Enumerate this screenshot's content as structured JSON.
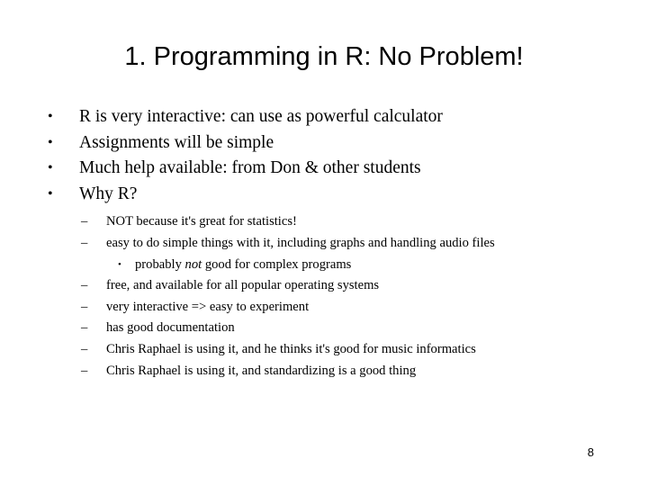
{
  "slide": {
    "title": "1. Programming in R: No Problem!",
    "background_color": "#ffffff",
    "text_color": "#000000",
    "page_number": "8",
    "markers": {
      "level1": "•",
      "level2": "–",
      "level3": "•"
    },
    "bullets": [
      {
        "level": 1,
        "text": "R is very interactive: can use as powerful calculator"
      },
      {
        "level": 1,
        "text": "Assignments will be simple"
      },
      {
        "level": 1,
        "text": "Much help available: from Don & other students"
      },
      {
        "level": 1,
        "text": "Why R?"
      },
      {
        "level": 2,
        "text": "NOT because it's great for statistics!"
      },
      {
        "level": 2,
        "text": "easy to do simple things with it, including graphs and handling audio files"
      },
      {
        "level": 3,
        "text_before": "probably ",
        "text_italic": "not",
        "text_after": " good for complex programs"
      },
      {
        "level": 2,
        "text": "free, and available for all popular operating systems"
      },
      {
        "level": 2,
        "text": "very interactive => easy to experiment"
      },
      {
        "level": 2,
        "text": "has good documentation"
      },
      {
        "level": 2,
        "text": "Chris Raphael is using it, and he thinks it's good for music informatics"
      },
      {
        "level": 2,
        "text": "Chris Raphael is using it, and standardizing is a good thing"
      }
    ]
  }
}
